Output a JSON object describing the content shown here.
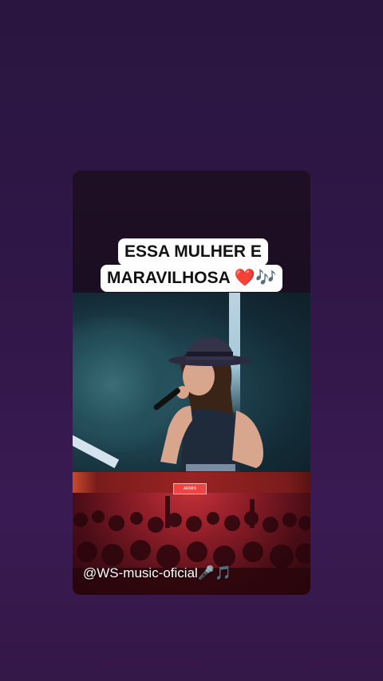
{
  "post": {
    "caption_line1": "ESSA MULHER E",
    "caption_line2": "MARAVILHOSA ❤️🎶",
    "watermark": "@WS-music-oficial🎤🎵"
  },
  "stage_sign": "ARMIN",
  "colors": {
    "background": "#2f1747",
    "caption_bg": "#ffffff",
    "caption_text": "#111111",
    "crowd_red": "#c8323b"
  }
}
